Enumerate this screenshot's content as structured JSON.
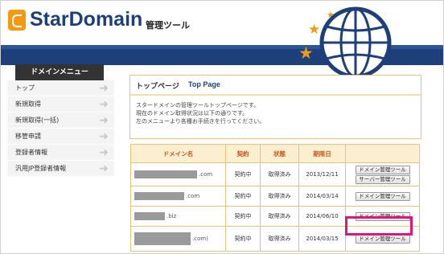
{
  "header": {
    "logo_text": "StarDomain",
    "logo_subtitle": "管理ツール",
    "colors": {
      "brand_navy": "#1d3f7a",
      "brand_orange": "#f39a12",
      "highlight_pink": "#e4157a"
    }
  },
  "sidebar": {
    "title": "ドメインメニュー",
    "items": [
      {
        "label": "トップ"
      },
      {
        "label": "新規取得"
      },
      {
        "label": "新規取得(一括)"
      },
      {
        "label": "移管申請"
      },
      {
        "label": "登録者情報"
      },
      {
        "label": "汎用JP登録者情報"
      }
    ]
  },
  "main": {
    "title_ja": "トップページ",
    "title_en": "Top Page",
    "intro_lines": [
      "スタードメインの管理ツールトップページです。",
      "現在のドメイン取得状況は以下の通りです。",
      "左のメニューより各種お手続きを行ってください。"
    ]
  },
  "table": {
    "headers": [
      "ドメイン名",
      "契約",
      "状態",
      "期限日",
      ""
    ],
    "rows": [
      {
        "suffix": ".com",
        "contract": "契約中",
        "status": "取得済み",
        "expiry": "2013/12/11",
        "buttons": [
          "ドメイン管理ツール",
          "サーバー管理ツール"
        ]
      },
      {
        "suffix": ".com",
        "contract": "契約中",
        "status": "取得済み",
        "expiry": "2014/03/14",
        "buttons": [
          "ドメイン管理ツール"
        ]
      },
      {
        "suffix": ".biz",
        "contract": "契約中",
        "status": "取得済み",
        "expiry": "2014/06/10",
        "buttons": [
          "ドメイン管理ツール"
        ]
      },
      {
        "suffix": ".com)",
        "contract": "契約中",
        "status": "取得済み",
        "expiry": "2014/03/15",
        "buttons": [
          "ドメイン管理ツール"
        ]
      }
    ]
  }
}
